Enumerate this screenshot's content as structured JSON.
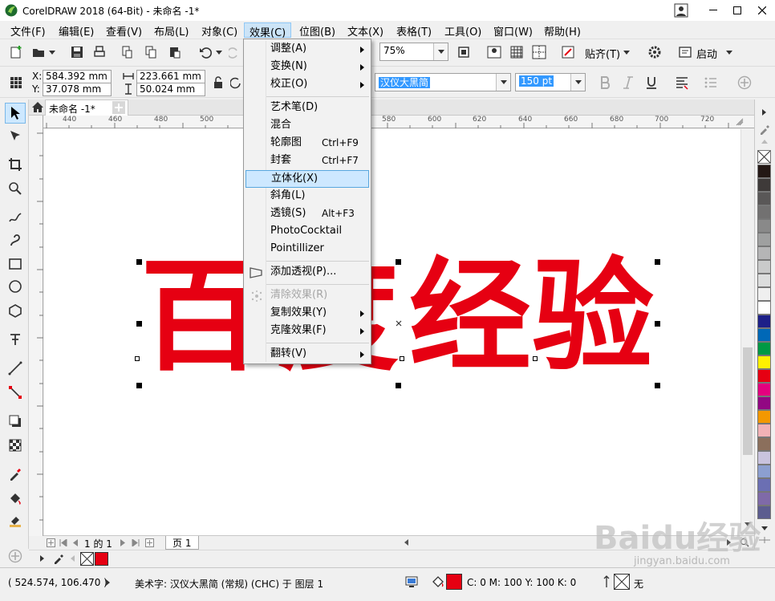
{
  "titlebar": {
    "title": "CorelDRAW 2018 (64-Bit) - 未命名 -1*"
  },
  "menubar": {
    "items": [
      "文件(F)",
      "编辑(E)",
      "查看(V)",
      "布局(L)",
      "对象(C)",
      "效果(C)",
      "位图(B)",
      "文本(X)",
      "表格(T)",
      "工具(O)",
      "窗口(W)",
      "帮助(H)"
    ],
    "active_index": 5
  },
  "toolbar": {
    "zoom": "75%",
    "snap_label": "贴齐(T)",
    "launch_label": "启动"
  },
  "propbar": {
    "x_label": "X:",
    "x_value": "584.392 mm",
    "y_label": "Y:",
    "y_value": "37.078 mm",
    "w_value": "223.661 mm",
    "h_value": "50.024 mm",
    "font_name": "汉仪大黑简",
    "font_size": "150 pt"
  },
  "document": {
    "tab_title": "未命名 -1*",
    "ruler_ticks": [
      "440",
      "460",
      "480",
      "500",
      "580",
      "600",
      "620",
      "640",
      "660",
      "680",
      "700",
      "720"
    ],
    "canvas_text": [
      "百",
      "度",
      "经",
      "验"
    ]
  },
  "effects_menu": {
    "items": [
      {
        "label": "调整(A)",
        "submenu": true
      },
      {
        "label": "变换(N)",
        "submenu": true
      },
      {
        "label": "校正(O)",
        "submenu": true
      },
      {
        "label": "艺术笔(D)"
      },
      {
        "label": "混合"
      },
      {
        "label": "轮廓图",
        "shortcut": "Ctrl+F9"
      },
      {
        "label": "封套",
        "shortcut": "Ctrl+F7"
      },
      {
        "label": "立体化(X)",
        "highlighted": true
      },
      {
        "label": "斜角(L)"
      },
      {
        "label": "透镜(S)",
        "shortcut": "Alt+F3"
      },
      {
        "label": "PhotoCocktail"
      },
      {
        "label": "Pointillizer"
      },
      {
        "label": "添加透视(P)..."
      },
      {
        "label": "清除效果(R)",
        "disabled": true
      },
      {
        "label": "复制效果(Y)",
        "submenu": true
      },
      {
        "label": "克隆效果(F)",
        "submenu": true
      },
      {
        "label": "翻转(V)",
        "submenu": true
      }
    ]
  },
  "pagenav": {
    "page_of": "1 的 1",
    "page_tab": "页 1"
  },
  "statusbar": {
    "coords": "( 524.574, 106.470 )",
    "object_info": "美术字: 汉仪大黑简 (常规) (CHC) 于 图层 1",
    "fill_info": "C: 0 M: 100 Y: 100 K: 0",
    "outline_info": "无"
  },
  "colors": {
    "accent": "#e60012",
    "menu_highlight": "#cde8ff",
    "selection": "#3399ff"
  },
  "palette": [
    "#231815",
    "#3e3a39",
    "#595757",
    "#727171",
    "#898989",
    "#9fa0a0",
    "#b5b5b6",
    "#c9caca",
    "#dcdddd",
    "#efefef",
    "#ffffff",
    "#1d2088",
    "#0068b7",
    "#009944",
    "#fff100",
    "#e60012",
    "#e4007f",
    "#920783",
    "#f39800",
    "#f2b2b6",
    "#8b6f5c",
    "#c9c3de",
    "#8c9fd0",
    "#6b6fb3",
    "#7f6aa8",
    "#5c5d8f"
  ],
  "watermark": {
    "text": "Baidu经验",
    "sub": "jingyan.baidu.com"
  }
}
